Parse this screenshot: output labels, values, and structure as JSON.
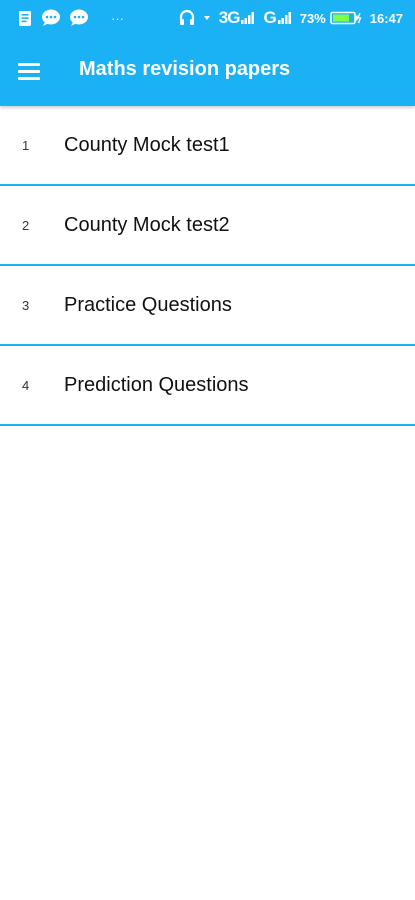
{
  "status_bar": {
    "battery_percent": "73%",
    "time": "16:47",
    "network_3g": "3G",
    "network_g": "G",
    "overflow": "···",
    "icons": [
      "note-icon",
      "chat-bubble-icon",
      "chat-bubble-icon",
      "headset-icon",
      "wifi-dot-icon",
      "signal-icon",
      "signal-icon",
      "battery-icon"
    ]
  },
  "toolbar": {
    "title": "Maths revision papers",
    "menu_icon": "hamburger-menu-icon"
  },
  "list": {
    "items": [
      {
        "number": "1",
        "label": "County Mock test1"
      },
      {
        "number": "2",
        "label": "County Mock test2"
      },
      {
        "number": "3",
        "label": "Practice Questions"
      },
      {
        "number": "4",
        "label": "Prediction Questions"
      }
    ]
  },
  "colors": {
    "primary": "#1ab2f5",
    "divider": "#1ab2f5",
    "background": "#ffffff"
  }
}
